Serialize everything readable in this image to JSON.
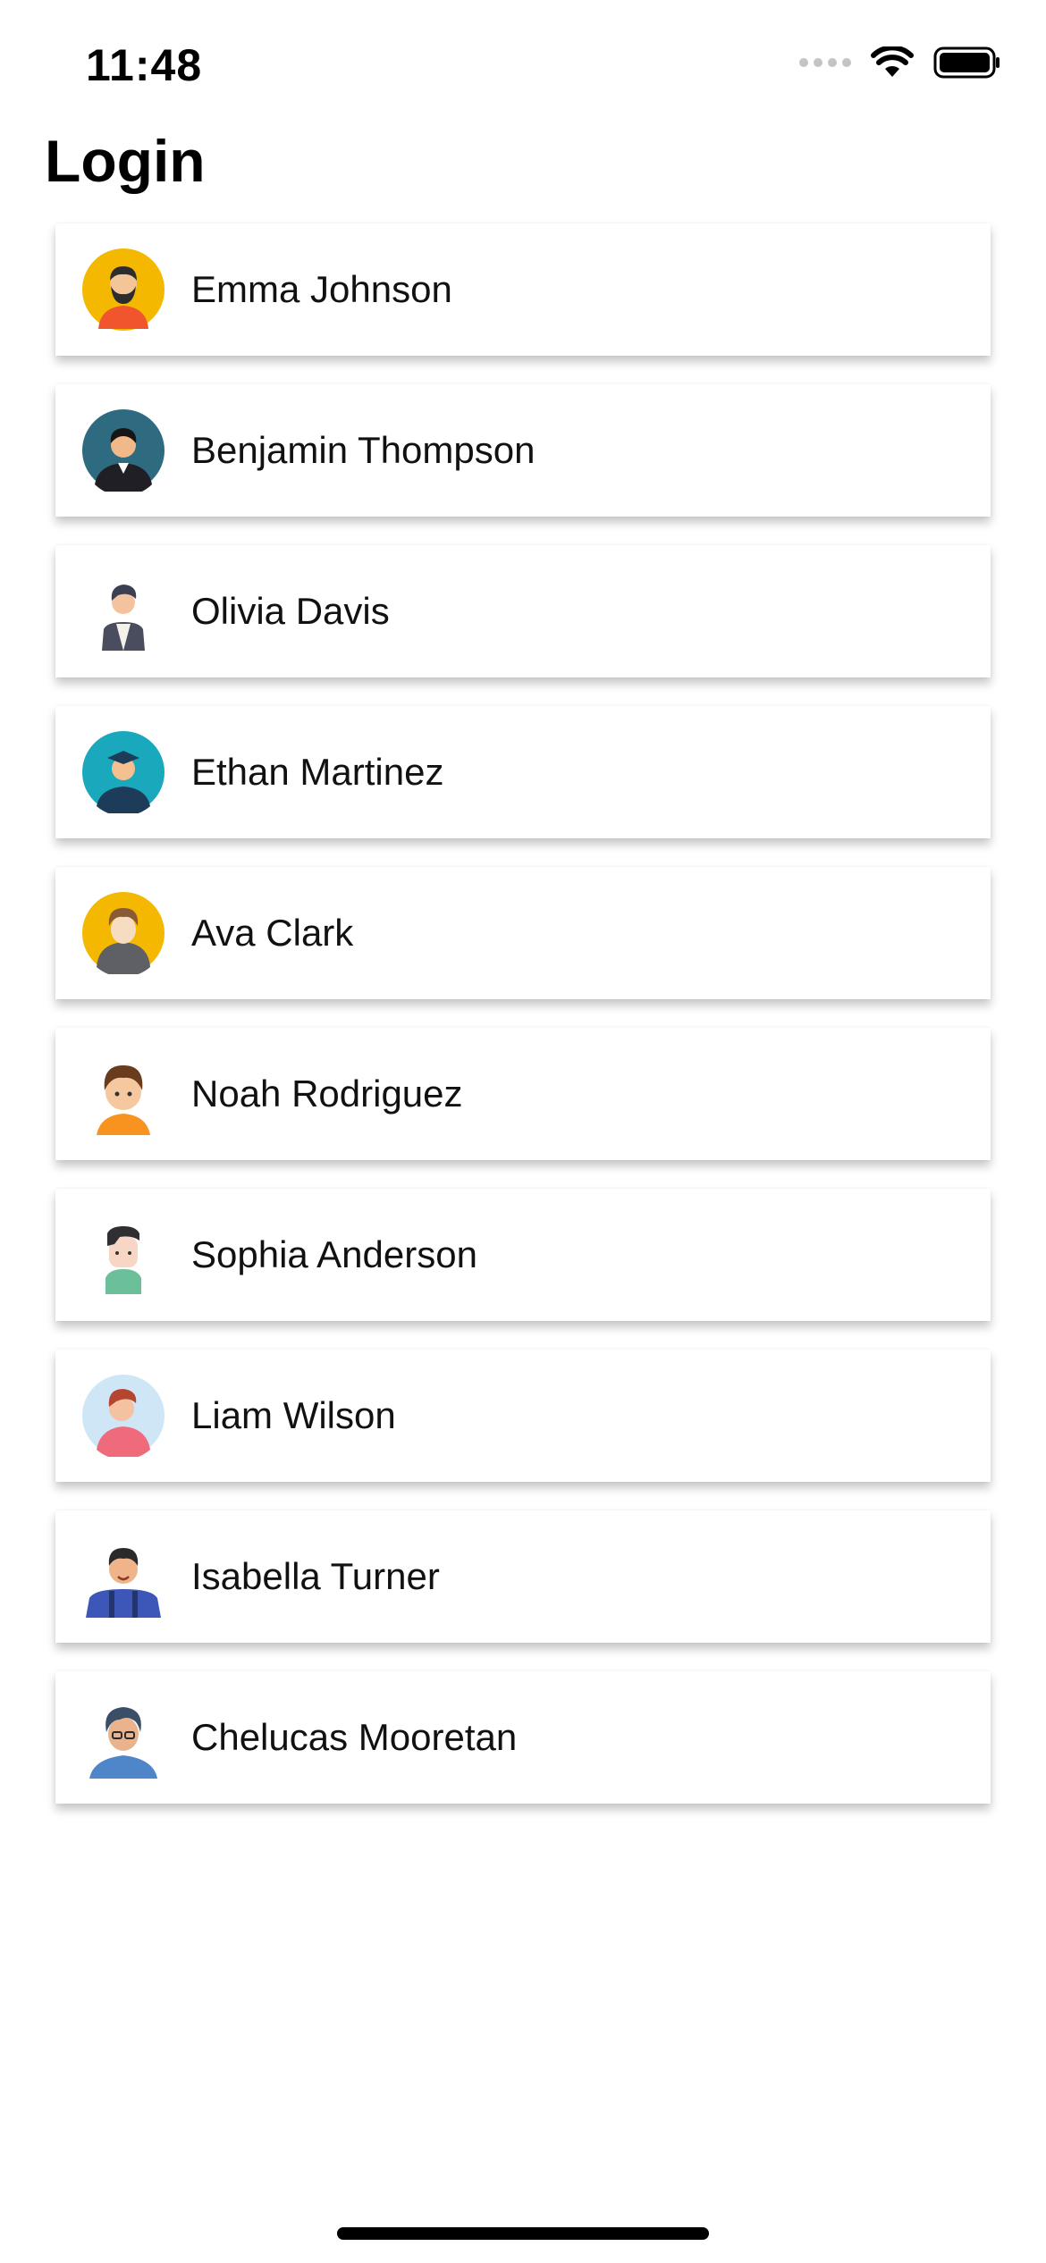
{
  "status_bar": {
    "time": "11:48"
  },
  "page": {
    "title": "Login"
  },
  "users": [
    {
      "name": "Emma Johnson",
      "avatar": "bearded-man-yellow-avatar-icon"
    },
    {
      "name": "Benjamin Thompson",
      "avatar": "businessman-teal-avatar-icon"
    },
    {
      "name": "Olivia Davis",
      "avatar": "man-gray-suit-avatar-icon"
    },
    {
      "name": "Ethan Martinez",
      "avatar": "graduate-cyan-avatar-icon"
    },
    {
      "name": "Ava Clark",
      "avatar": "hoodie-man-yellow-avatar-icon"
    },
    {
      "name": "Noah Rodriguez",
      "avatar": "boy-orange-shirt-avatar-icon"
    },
    {
      "name": "Sophia Anderson",
      "avatar": "man-green-shirt-avatar-icon"
    },
    {
      "name": "Liam Wilson",
      "avatar": "woman-pink-shirt-avatar-icon"
    },
    {
      "name": "Isabella Turner",
      "avatar": "man-suspenders-avatar-icon"
    },
    {
      "name": "Chelucas Mooretan",
      "avatar": "curly-hair-man-avatar-icon"
    }
  ]
}
